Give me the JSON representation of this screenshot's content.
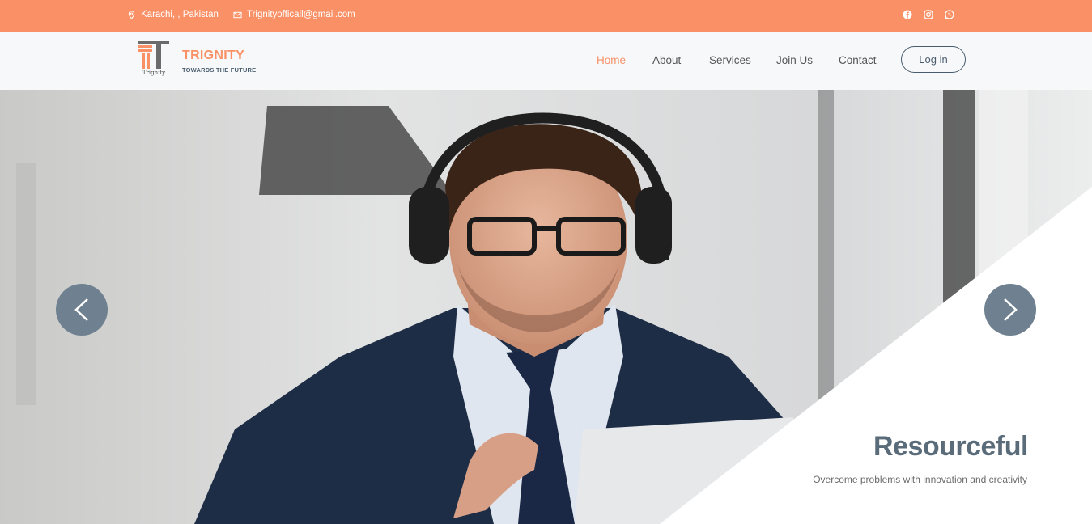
{
  "topbar": {
    "location": "Karachi, , Pakistan",
    "email": "Trignityofficall@gmail.com",
    "location_icon": "map-pin-icon",
    "email_icon": "envelope-icon",
    "socials": [
      "facebook-icon",
      "instagram-icon",
      "whatsapp-icon"
    ]
  },
  "brand": {
    "logo_caption": "Trignity",
    "name": "TRIGNITY",
    "tagline": "TOWARDS THE FUTURE"
  },
  "nav": {
    "items": [
      {
        "label": "Home",
        "active": true
      },
      {
        "label": "About",
        "active": false
      },
      {
        "label": "Services",
        "active": false
      },
      {
        "label": "Join Us",
        "active": false
      },
      {
        "label": "Contact",
        "active": false
      }
    ],
    "login_label": "Log in"
  },
  "hero": {
    "title": "Resourceful",
    "subtitle": "Overcome problems with innovation and creativity",
    "prev_icon": "chevron-left-icon",
    "next_icon": "chevron-right-icon"
  },
  "colors": {
    "accent": "#f99066",
    "slate": "#4a5d6e",
    "arrow_bg": "#6f8190"
  }
}
